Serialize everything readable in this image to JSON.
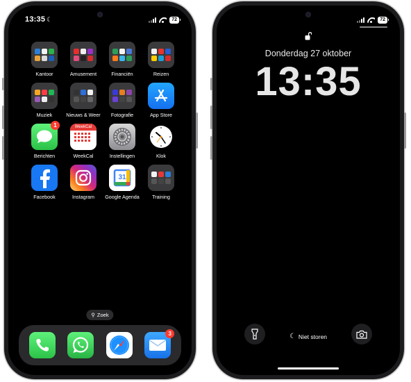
{
  "status": {
    "time": "13:35",
    "battery": "72"
  },
  "home": {
    "apps": [
      {
        "label": "Kantoor",
        "kind": "folder"
      },
      {
        "label": "Amusement",
        "kind": "folder"
      },
      {
        "label": "Financiën",
        "kind": "folder"
      },
      {
        "label": "Reizen",
        "kind": "folder"
      },
      {
        "label": "Muziek",
        "kind": "folder"
      },
      {
        "label": "Nieuws & Weer",
        "kind": "folder"
      },
      {
        "label": "Fotografie",
        "kind": "folder"
      },
      {
        "label": "App Store",
        "kind": "appstore"
      },
      {
        "label": "Berichten",
        "kind": "messages",
        "badge": "1"
      },
      {
        "label": "WeekCal",
        "kind": "weekcal",
        "header": "WeekCal"
      },
      {
        "label": "Instellingen",
        "kind": "settings"
      },
      {
        "label": "Klok",
        "kind": "clock"
      },
      {
        "label": "Facebook",
        "kind": "facebook"
      },
      {
        "label": "Instagram",
        "kind": "instagram"
      },
      {
        "label": "Google Agenda",
        "kind": "gcal",
        "day": "31"
      },
      {
        "label": "Training",
        "kind": "folder"
      }
    ],
    "search_label": "Zoek",
    "dock": [
      {
        "name": "phone"
      },
      {
        "name": "whatsapp"
      },
      {
        "name": "safari"
      },
      {
        "name": "mail",
        "badge": "3"
      }
    ]
  },
  "lock": {
    "date": "Donderdag 27 oktober",
    "time": "13:35",
    "focus": "Niet storen"
  },
  "colors": {
    "messages": "#34c759",
    "appstore": "#1a8cff",
    "facebook": "#1877f2",
    "badge": "#ff3b30",
    "folder": "#3a3a3c"
  }
}
